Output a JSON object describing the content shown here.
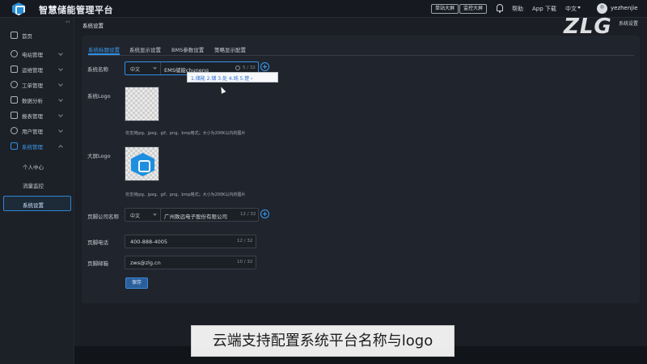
{
  "header": {
    "app_title": "智慧储能管理平台",
    "btn_station_screen": "单站大屏",
    "btn_monitor_screen": "监控大屏",
    "help": "帮助",
    "app_download": "App 下载",
    "language": "中文",
    "username": "yezhenjie"
  },
  "watermark": {
    "brand": "ZLG",
    "sub": "系统设置"
  },
  "sidebar": {
    "items": [
      {
        "label": "首页"
      },
      {
        "label": "电站管理"
      },
      {
        "label": "运维管理"
      },
      {
        "label": "工单管理"
      },
      {
        "label": "数据分析"
      },
      {
        "label": "报表管理"
      },
      {
        "label": "用户管理"
      },
      {
        "label": "系统管理"
      }
    ],
    "sub_items": [
      {
        "label": "个人中心"
      },
      {
        "label": "流量监控"
      },
      {
        "label": "系统设置"
      }
    ]
  },
  "breadcrumb": "系统设置",
  "tabs": [
    {
      "label": "系统标题设置"
    },
    {
      "label": "系统显示设置"
    },
    {
      "label": "BMS参数设置"
    },
    {
      "label": "策略显示配置"
    }
  ],
  "form": {
    "system_name": {
      "label": "系统名称",
      "lang": "中文",
      "value": "EMS储能chuneng",
      "count": "5 / 32"
    },
    "ime": {
      "candidates": "1.储能 2.储 3.处 4.纯 5.楚 ›"
    },
    "system_logo": {
      "label": "系统Logo",
      "hint": "仅支持jpg、jpeg、gif、png、bmp格式；大小为200K以内的图片"
    },
    "screen_logo": {
      "label": "大屏Logo",
      "hint": "仅支持jpg、jpeg、gif、png、bmp格式；大小为200K以内的图片"
    },
    "footer_company": {
      "label": "页脚公司名称",
      "lang": "中文",
      "value": "广州致远电子股份有限公司",
      "count": "12 / 32"
    },
    "footer_phone": {
      "label": "页脚电话",
      "value": "400-888-4005",
      "count": "12 / 32"
    },
    "footer_email": {
      "label": "页脚邮箱",
      "value": "zws@zlg.cn",
      "count": "10 / 32"
    },
    "save_label": "保存"
  },
  "caption": "云端支持配置系统平台名称与logo",
  "colors": {
    "accent": "#2f8fe8",
    "panel": "#20252d",
    "background": "#1b1e24"
  }
}
